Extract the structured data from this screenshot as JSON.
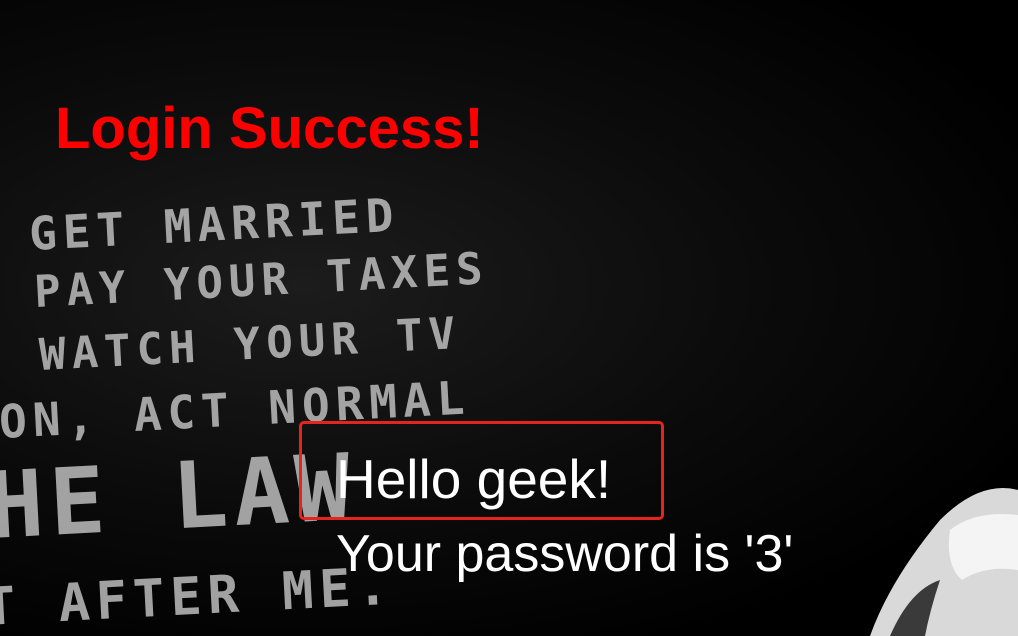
{
  "page": {
    "title": "Login Success!",
    "greeting": "Hello geek!",
    "password_message": "Your password is '3'"
  },
  "background": {
    "poster_lines": [
      "GET MARRIED",
      "PAY YOUR TAXES",
      "WATCH YOUR TV",
      "ON, ACT NORMAL",
      "HE LAW",
      "T AFTER ME."
    ]
  },
  "colors": {
    "title": "#ff0000",
    "highlight_border": "#e8231e",
    "text": "#ffffff",
    "background": "#000000"
  }
}
